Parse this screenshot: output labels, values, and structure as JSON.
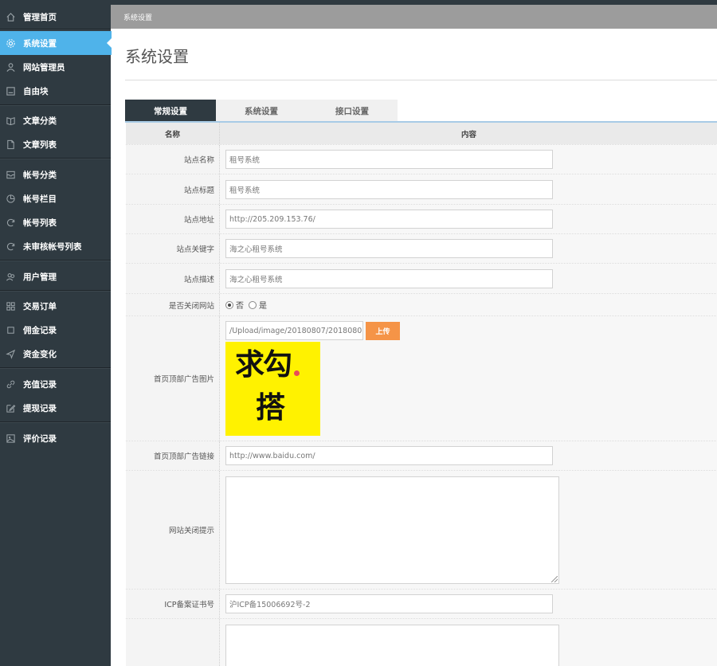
{
  "sidebar": {
    "items": [
      {
        "label": "管理首页",
        "icon": "home-icon"
      },
      {
        "label": "系统设置",
        "icon": "gear-icon"
      },
      {
        "label": "网站管理员",
        "icon": "user-icon"
      },
      {
        "label": "自由块",
        "icon": "block-icon"
      },
      {
        "label": "文章分类",
        "icon": "book-icon"
      },
      {
        "label": "文章列表",
        "icon": "file-icon"
      },
      {
        "label": "帐号分类",
        "icon": "inbox-icon"
      },
      {
        "label": "帐号栏目",
        "icon": "pie-icon"
      },
      {
        "label": "帐号列表",
        "icon": "refresh-icon"
      },
      {
        "label": "未审核帐号列表",
        "icon": "refresh-icon"
      },
      {
        "label": "用户管理",
        "icon": "users-icon"
      },
      {
        "label": "交易订单",
        "icon": "grid-icon"
      },
      {
        "label": "佣金记录",
        "icon": "square-icon"
      },
      {
        "label": "资金变化",
        "icon": "send-icon"
      },
      {
        "label": "充值记录",
        "icon": "link-icon"
      },
      {
        "label": "提现记录",
        "icon": "edit-icon"
      },
      {
        "label": "评价记录",
        "icon": "image-icon"
      }
    ],
    "active_index": 1
  },
  "breadcrumb": "系统设置",
  "page_title": "系统设置",
  "tabs": [
    {
      "label": "常规设置",
      "active": true
    },
    {
      "label": "系统设置",
      "active": false
    },
    {
      "label": "接口设置",
      "active": false
    }
  ],
  "table": {
    "header_name": "名称",
    "header_content": "内容",
    "site_name": {
      "label": "站点名称",
      "value": "租号系统"
    },
    "site_title": {
      "label": "站点标题",
      "value": "租号系统"
    },
    "site_url": {
      "label": "站点地址",
      "value": "http://205.209.153.76/"
    },
    "site_keywords": {
      "label": "站点关键字",
      "value": "海之心租号系统"
    },
    "site_description": {
      "label": "站点描述",
      "value": "海之心租号系统"
    },
    "site_closed": {
      "label": "是否关闭网站",
      "option_no": "否",
      "option_yes": "是",
      "selected": "否"
    },
    "ad_image": {
      "label": "首页顶部广告图片",
      "path": "/Upload/image/20180807/201808071",
      "upload_label": "上传",
      "image_text_top": "求勾",
      "image_text_bottom": "搭"
    },
    "ad_link": {
      "label": "首页顶部广告链接",
      "value": "http://www.baidu.com/"
    },
    "close_notice": {
      "label": "网站关闭提示",
      "value": ""
    },
    "icp": {
      "label": "ICP备案证书号",
      "value": "沪ICP备15006692号-2"
    }
  },
  "colors": {
    "sidebar_bg": "#2f3a41",
    "active_item": "#4fb3ea",
    "upload_button": "#f59447",
    "ad_image_bg": "#fff200"
  }
}
